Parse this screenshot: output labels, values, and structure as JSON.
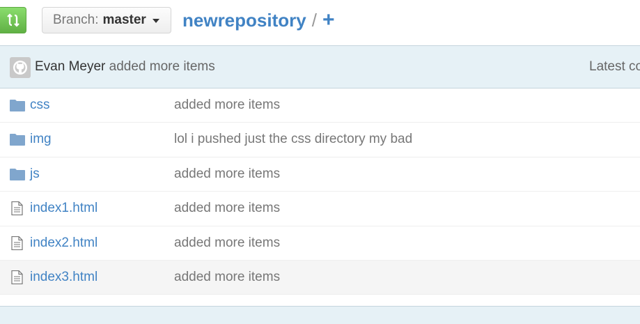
{
  "header": {
    "branch_prefix": "Branch:",
    "branch_name": "master",
    "repo_name": "newrepository",
    "separator": "/",
    "add_file": "+"
  },
  "commit": {
    "author": "Evan Meyer",
    "message": "added more items",
    "latest_label": "Latest co"
  },
  "files": [
    {
      "type": "folder",
      "name": "css",
      "message": "added more items"
    },
    {
      "type": "folder",
      "name": "img",
      "message": "lol i pushed just the css directory my bad"
    },
    {
      "type": "folder",
      "name": "js",
      "message": "added more items"
    },
    {
      "type": "file",
      "name": "index1.html",
      "message": "added more items"
    },
    {
      "type": "file",
      "name": "index2.html",
      "message": "added more items"
    },
    {
      "type": "file",
      "name": "index3.html",
      "message": "added more items"
    }
  ],
  "colors": {
    "link": "#4183c4",
    "compare_green": "#60b044",
    "commit_bar_bg": "#e6f1f6",
    "folder_icon": "#80a6cd",
    "muted_text": "#777777"
  },
  "icons": {
    "compare": "compare-arrows-icon",
    "avatar": "github-octocat-icon",
    "folder": "folder-icon",
    "file": "file-text-icon",
    "caret": "caret-down-icon"
  }
}
